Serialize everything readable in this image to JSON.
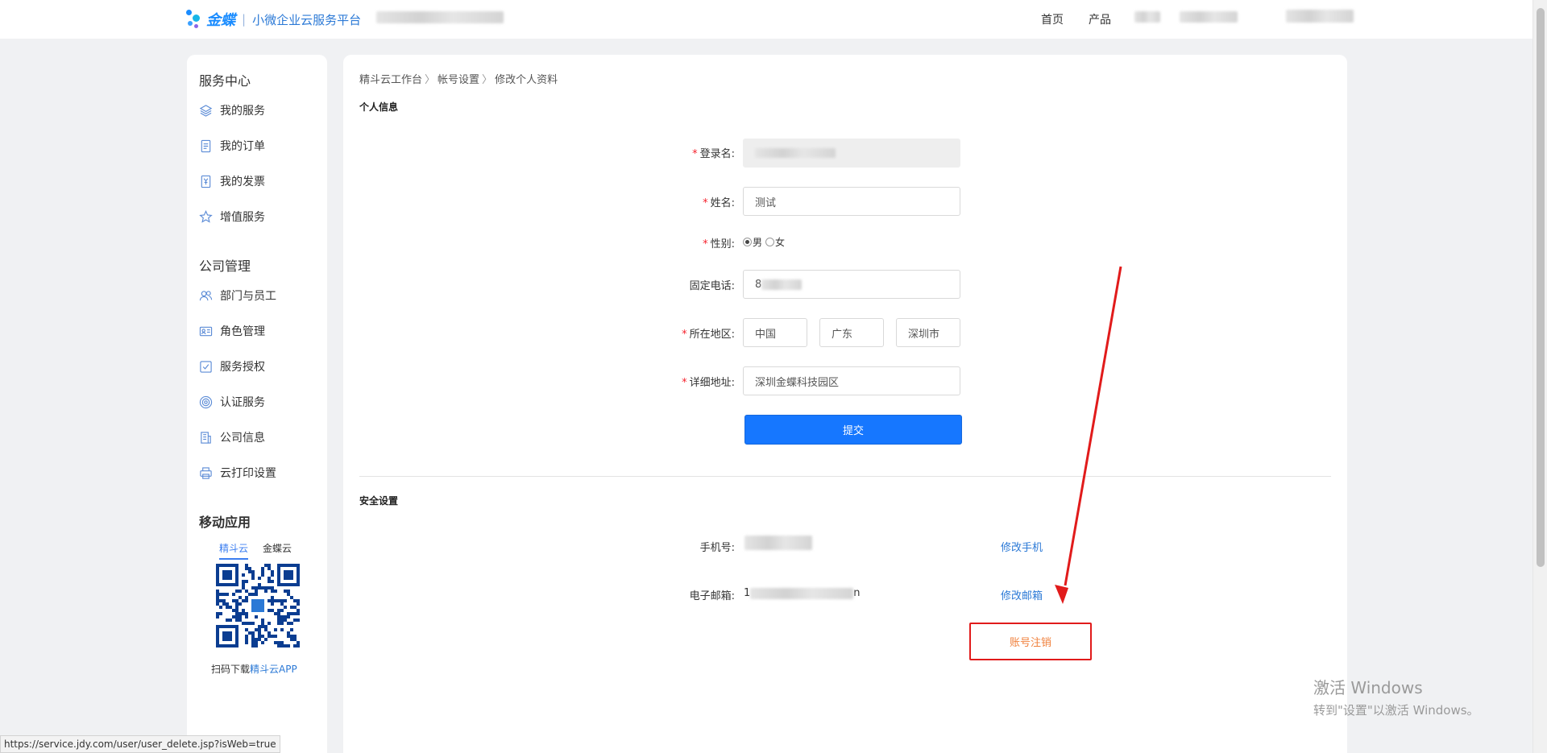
{
  "header": {
    "brand": "金蝶",
    "separator": "|",
    "subtitle": "小微企业云服务平台",
    "nav": [
      "首页",
      "产品"
    ]
  },
  "sidebar": {
    "service_center_title": "服务中心",
    "service_items": [
      {
        "label": "我的服务",
        "icon": "layers-icon"
      },
      {
        "label": "我的订单",
        "icon": "document-icon"
      },
      {
        "label": "我的发票",
        "icon": "invoice-icon"
      },
      {
        "label": "增值服务",
        "icon": "star-icon"
      }
    ],
    "company_title": "公司管理",
    "company_items": [
      {
        "label": "部门与员工",
        "icon": "users-icon"
      },
      {
        "label": "角色管理",
        "icon": "id-card-icon"
      },
      {
        "label": "服务授权",
        "icon": "checkbox-icon"
      },
      {
        "label": "认证服务",
        "icon": "target-icon"
      },
      {
        "label": "公司信息",
        "icon": "building-icon"
      },
      {
        "label": "云打印设置",
        "icon": "printer-icon"
      }
    ],
    "mobile_title": "移动应用",
    "mobile_tabs": [
      "精斗云",
      "金蝶云"
    ],
    "mobile_active_tab": "精斗云",
    "qr_caption_prefix": "扫码下载",
    "qr_caption_link": "精斗云APP"
  },
  "main": {
    "breadcrumb": [
      "精斗云工作台",
      "帐号设置",
      "修改个人资料"
    ],
    "personal_title": "个人信息",
    "form": {
      "login_label": "登录名:",
      "name_label": "姓名:",
      "name_value": "测试",
      "gender_label": "性别:",
      "gender_options": [
        "男",
        "女"
      ],
      "gender_selected": "男",
      "phone_label": "固定电话:",
      "phone_value_visible": "8",
      "region_label": "所在地区:",
      "region_country": "中国",
      "region_province": "广东",
      "region_city": "深圳市",
      "address_label": "详细地址:",
      "address_value": "深圳金蝶科技园区",
      "submit_label": "提交"
    },
    "security_title": "安全设置",
    "security": {
      "mobile_label": "手机号:",
      "mobile_action": "修改手机",
      "email_label": "电子邮箱:",
      "email_prefix": "1",
      "email_suffix": "n",
      "email_action": "修改邮箱",
      "cancel_account": "账号注销"
    }
  },
  "watermark": {
    "title": "激活 Windows",
    "subtitle": "转到\"设置\"以激活 Windows。"
  },
  "status_url": "https://service.jdy.com/user/user_delete.jsp?isWeb=true",
  "colors": {
    "primary": "#1677ff",
    "link": "#2b79d6",
    "required": "#f5222d",
    "annotation_red": "#e11b1b",
    "cancel_text": "#f0813d"
  }
}
